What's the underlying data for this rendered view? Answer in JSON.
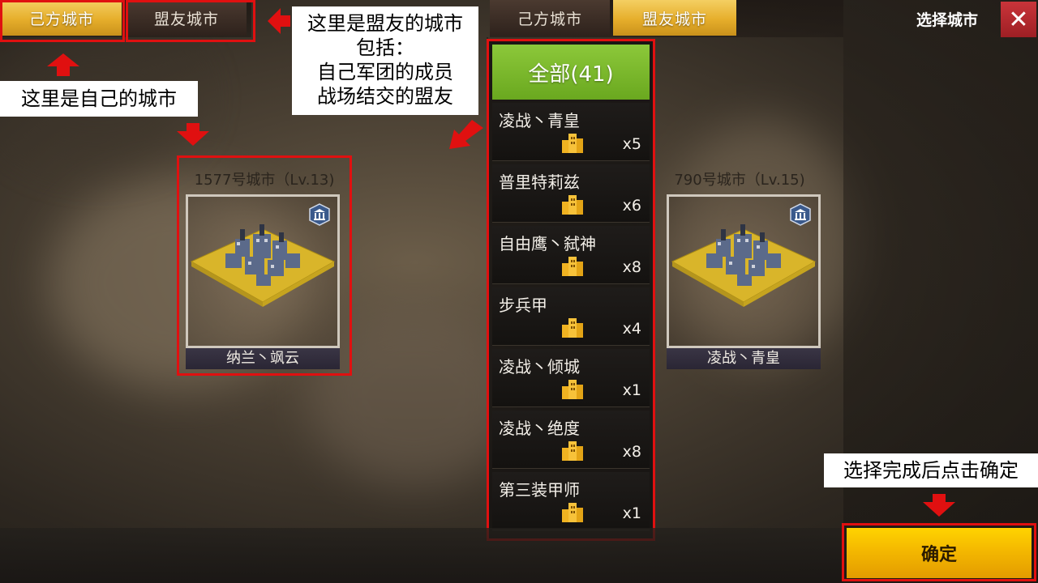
{
  "colors": {
    "gold_tab": "#e6ae2b",
    "dark_tab": "#2e221c",
    "annotation_red": "#e01010",
    "all_button_green": "#7bb82c",
    "confirm_yellow": "#f4b800",
    "close_red": "#b82a30"
  },
  "left_tabs": {
    "own_city": "己方城市",
    "ally_city": "盟友城市"
  },
  "right_tabs": {
    "own_city": "己方城市",
    "ally_city": "盟友城市"
  },
  "header": {
    "title": "选择城市",
    "close_icon": "close-icon"
  },
  "annotations": {
    "own_city_note": "这里是自己的城市",
    "ally_city_note_line1": "这里是盟友的城市",
    "ally_city_note_line2": "包括：",
    "ally_city_note_line3": "自己军团的成员",
    "ally_city_note_line4": "战场结交的盟友",
    "confirm_note": "选择完成后点击确定"
  },
  "own_city": {
    "caption": "1577号城市（Lv.13)",
    "name": "纳兰丶飒云",
    "badge_icon": "government-icon"
  },
  "ally_city": {
    "caption": "790号城市（Lv.15)",
    "name": "凌战丶青皇",
    "badge_icon": "government-icon"
  },
  "ally_list": {
    "all_label": "全部(41)",
    "items": [
      {
        "name": "凌战丶青皇",
        "count": "x5"
      },
      {
        "name": "普里特莉兹",
        "count": "x6"
      },
      {
        "name": "自由鹰丶弑神",
        "count": "x8"
      },
      {
        "name": "步兵甲",
        "count": "x4"
      },
      {
        "name": "凌战丶倾城",
        "count": "x1"
      },
      {
        "name": "凌战丶绝度",
        "count": "x8"
      },
      {
        "name": "第三装甲师",
        "count": "x1"
      }
    ]
  },
  "confirm": {
    "label": "确定"
  }
}
